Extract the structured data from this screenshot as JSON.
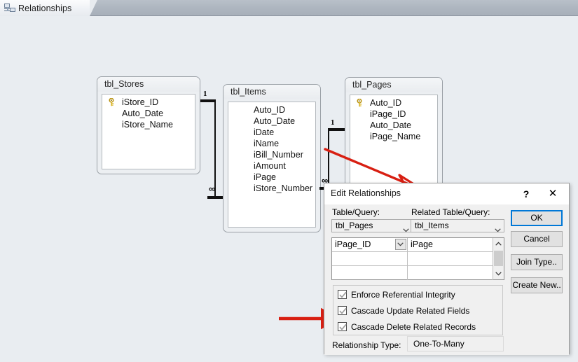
{
  "tab": {
    "label": "Relationships",
    "icon": "relationships-icon"
  },
  "tables": [
    {
      "name": "tbl_Stores",
      "fields": [
        {
          "name": "iStore_ID",
          "key": true
        },
        {
          "name": "Auto_Date",
          "key": false
        },
        {
          "name": "iStore_Name",
          "key": false
        }
      ]
    },
    {
      "name": "tbl_Items",
      "fields": [
        {
          "name": "Auto_ID",
          "key": false
        },
        {
          "name": "Auto_Date",
          "key": false
        },
        {
          "name": "iDate",
          "key": false
        },
        {
          "name": "iName",
          "key": false
        },
        {
          "name": "iBill_Number",
          "key": false
        },
        {
          "name": "iAmount",
          "key": false
        },
        {
          "name": "iPage",
          "key": false
        },
        {
          "name": "iStore_Number",
          "key": false
        }
      ]
    },
    {
      "name": "tbl_Pages",
      "fields": [
        {
          "name": "Auto_ID",
          "key": true
        },
        {
          "name": "iPage_ID",
          "key": false
        },
        {
          "name": "Auto_Date",
          "key": false
        },
        {
          "name": "iPage_Name",
          "key": false
        }
      ]
    }
  ],
  "relationships": [
    {
      "one": "1",
      "many": "∞"
    },
    {
      "one": "1",
      "many": "∞"
    }
  ],
  "dialog": {
    "title": "Edit Relationships",
    "help_label": "?",
    "close_label": "✕",
    "table_query_label": "Table/Query:",
    "related_table_query_label": "Related Table/Query:",
    "table_query_value": "tbl_Pages",
    "related_table_query_value": "tbl_Items",
    "grid": {
      "rows": [
        {
          "left": "iPage_ID",
          "right": "iPage"
        },
        {
          "left": "",
          "right": ""
        },
        {
          "left": "",
          "right": ""
        }
      ]
    },
    "checkboxes": [
      {
        "label": "Enforce Referential Integrity",
        "checked": true
      },
      {
        "label": "Cascade Update Related Fields",
        "checked": true
      },
      {
        "label": "Cascade Delete Related Records",
        "checked": true
      }
    ],
    "relationship_type_label": "Relationship Type:",
    "relationship_type_value": "One-To-Many",
    "buttons": [
      {
        "label": "OK",
        "primary": true
      },
      {
        "label": "Cancel",
        "primary": false
      },
      {
        "label": "Join Type..",
        "primary": false
      },
      {
        "label": "Create New..",
        "primary": false
      }
    ]
  },
  "annotations": {
    "arrow_color": "#d81f12",
    "arrow_to_dialog_title": "annotation-arrow-to-dialog",
    "arrow_to_cascade_update": "annotation-arrow-to-cascade-update"
  },
  "colors": {
    "canvas_bg": "#e9edf1",
    "tabstrip_bg": "#aeb6c0",
    "accent": "#0078d7",
    "key_icon": "#d4b429"
  }
}
